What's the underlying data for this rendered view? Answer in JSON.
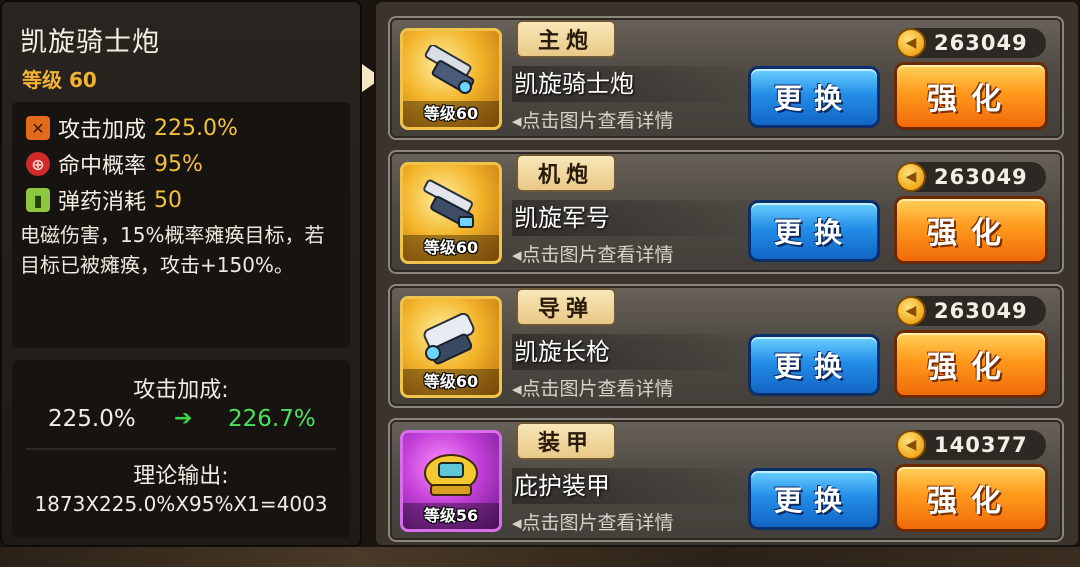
{
  "selected": {
    "name": "凯旋骑士炮",
    "level": "等级 60",
    "stats": [
      {
        "icon": "attack-icon",
        "label": "攻击加成",
        "value": "225.0%",
        "color": "#e46a1c"
      },
      {
        "icon": "crosshair-icon",
        "label": "命中概率",
        "value": "95%",
        "color": "#d12a2a"
      },
      {
        "icon": "ammo-icon",
        "label": "弹药消耗",
        "value": "50",
        "color": "#8dc63f"
      }
    ],
    "description": "电磁伤害，15%概率瘫痪目标，若目标已被瘫痪，攻击+150%。"
  },
  "calc": {
    "attack_title": "攻击加成:",
    "old_value": "225.0%",
    "arrow": "➔",
    "new_value": "226.7%",
    "output_title": "理论输出:",
    "formula": "1873X225.0%X95%X1=4003"
  },
  "slots": [
    {
      "slot": "主炮",
      "name": "凯旋骑士炮",
      "level": "等级60",
      "hint": "◂点击图片查看详情",
      "price": "263049",
      "change": "更换",
      "upgrade": "强化",
      "rarity": "gold"
    },
    {
      "slot": "机炮",
      "name": "凯旋军号",
      "level": "等级60",
      "hint": "◂点击图片查看详情",
      "price": "263049",
      "change": "更换",
      "upgrade": "强化",
      "rarity": "gold"
    },
    {
      "slot": "导弹",
      "name": "凯旋长枪",
      "level": "等级60",
      "hint": "◂点击图片查看详情",
      "price": "263049",
      "change": "更换",
      "upgrade": "强化",
      "rarity": "gold"
    },
    {
      "slot": "装甲",
      "name": "庇护装甲",
      "level": "等级56",
      "hint": "◂点击图片查看详情",
      "price": "140377",
      "change": "更换",
      "upgrade": "强化",
      "rarity": "purple"
    }
  ],
  "colors": {
    "accent_gold": "#f2b431",
    "green_increase": "#49e25a",
    "button_blue": "#238ee8",
    "button_orange": "#ff9a1c"
  }
}
